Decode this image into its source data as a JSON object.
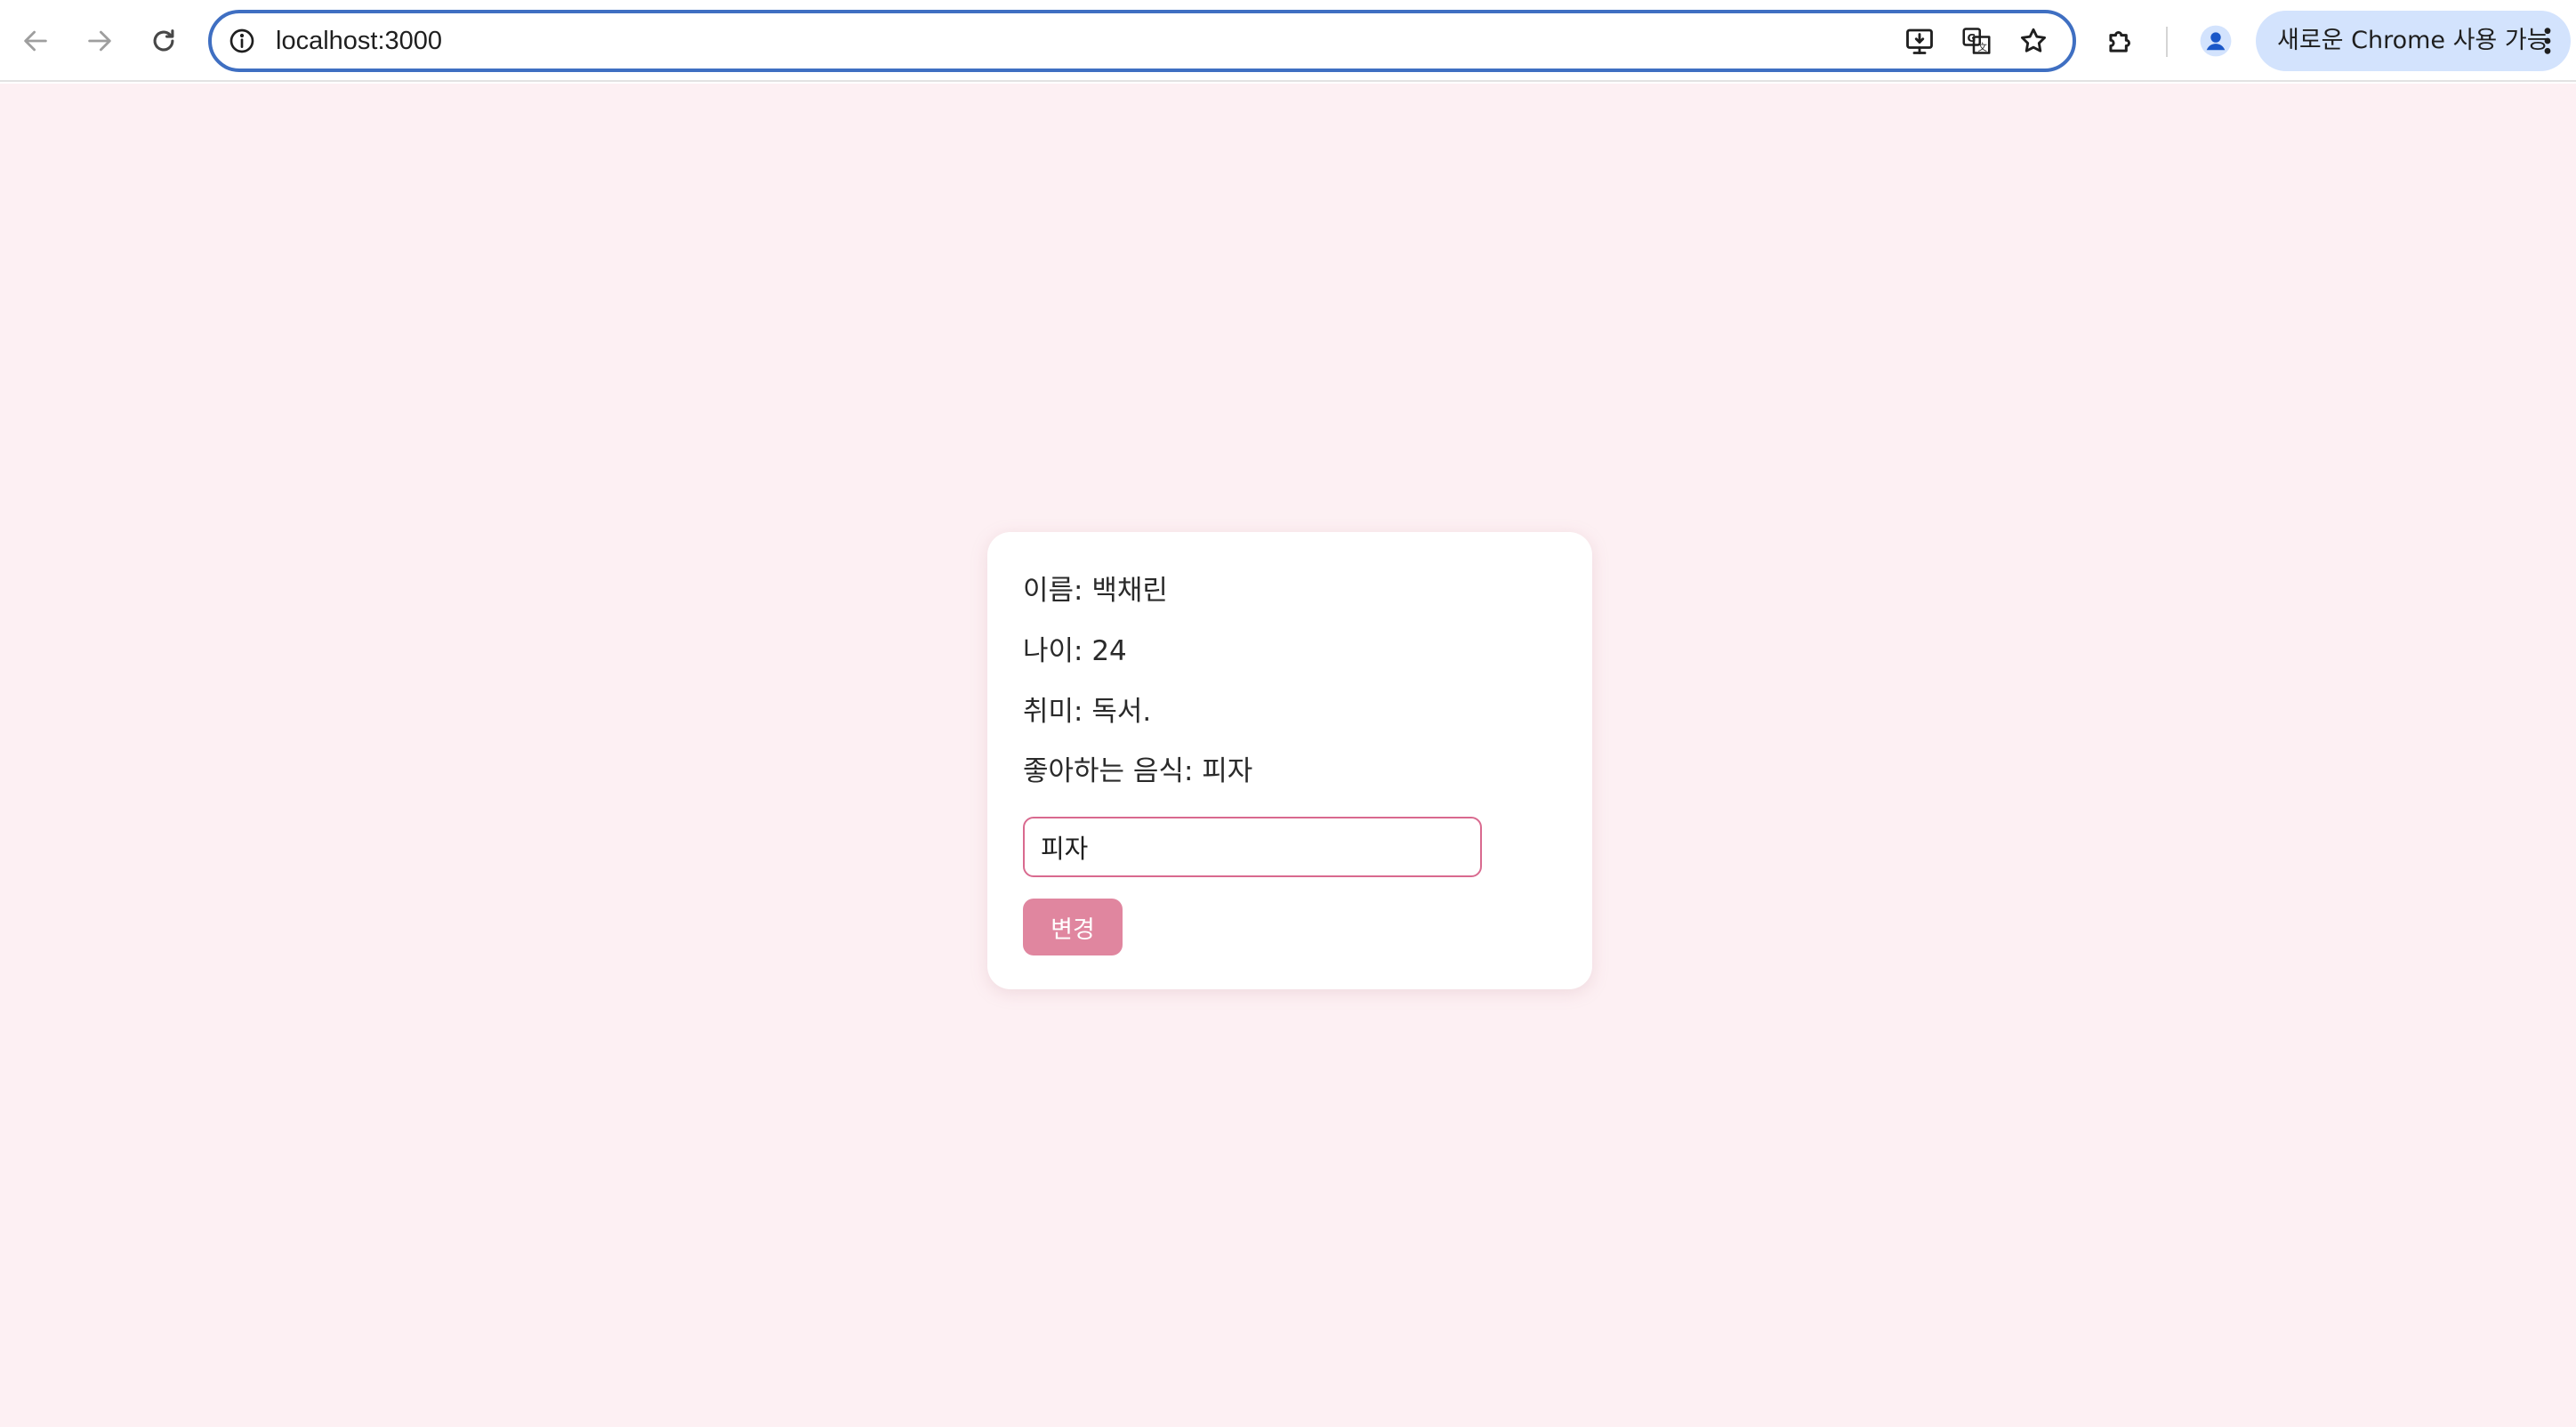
{
  "browser": {
    "url": "localhost:3000",
    "profile_chip_label": "새로운 Chrome 사용 가능"
  },
  "card": {
    "name_line": "이름: 백채린",
    "age_line": "나이: 24",
    "hobby_line": "취미: 독서.",
    "food_line": "좋아하는 음식: 피자",
    "food_input_value": "피자",
    "change_button_label": "변경"
  },
  "colors": {
    "page_background": "#fdf0f3",
    "accent": "#e0869f",
    "input_border": "#d96a8f",
    "omnibox_border": "#3f6fc2",
    "profile_chip": "#d3e3fd"
  }
}
